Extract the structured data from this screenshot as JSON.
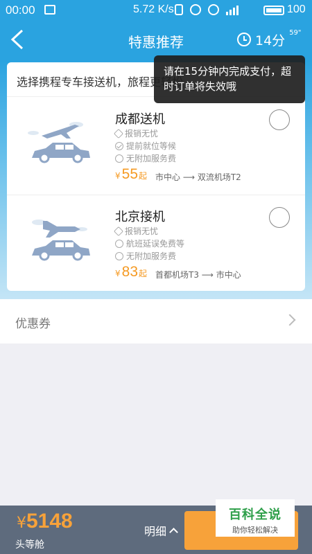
{
  "status_bar": {
    "time": "00:00",
    "speed": "5.72 K/s",
    "battery": "100"
  },
  "nav": {
    "title": "特惠推荐",
    "timer_minutes": "14分",
    "timer_seconds": "59\""
  },
  "notice": {
    "text": "选择携程专车接送机，旅程更轻松"
  },
  "tooltip": {
    "text": "请在15分钟内完成支付，超时订单将失效哦"
  },
  "services": [
    {
      "title": "成都送机",
      "features": [
        "报销无忧",
        "提前就位等候",
        "无附加服务费"
      ],
      "currency": "¥",
      "price": "55",
      "price_suffix": "起",
      "route": "市中心 ⟶ 双流机场T2"
    },
    {
      "title": "北京接机",
      "features": [
        "报销无忧",
        "航班延误免费等",
        "无附加服务费"
      ],
      "currency": "¥",
      "price": "83",
      "price_suffix": "起",
      "route": "首都机场T3 ⟶ 市中心"
    }
  ],
  "coupon": {
    "label": "优惠券"
  },
  "bottom_bar": {
    "currency": "¥",
    "total": "5148",
    "cabin": "头等舱",
    "detail_label": "明细"
  },
  "watermark": {
    "title": "百科全说",
    "subtitle": "助你轻松解决"
  },
  "colors": {
    "primary": "#2aa3e0",
    "accent": "#f7a23a",
    "bottom_bar": "#5e6b7d"
  }
}
